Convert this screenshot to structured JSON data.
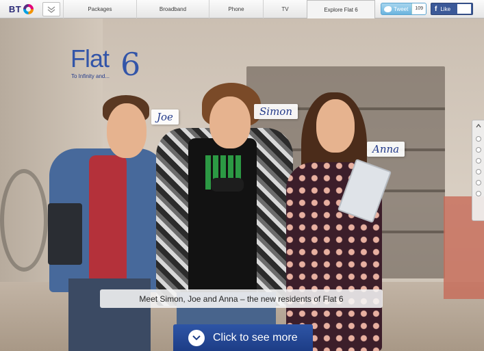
{
  "brand": {
    "logo_text": "BT"
  },
  "nav": {
    "tabs": [
      {
        "label": "Packages"
      },
      {
        "label": "Broadband"
      },
      {
        "label": "Phone"
      },
      {
        "label": "TV"
      },
      {
        "label": "Explore Flat 6"
      }
    ],
    "active_tab": "Explore Flat 6"
  },
  "social": {
    "tweet_label": "Tweet",
    "tweet_count": "109",
    "like_label": "Like"
  },
  "hero": {
    "logo_word": "Flat",
    "logo_number": "6",
    "logo_tagline": "To Infinity and...",
    "names": {
      "joe": "Joe",
      "simon": "Simon",
      "anna": "Anna"
    },
    "caption": "Meet Simon, Joe and Anna – the new residents of Flat 6",
    "cta_label": "Click to see more"
  },
  "side_nav": {
    "dot_count": 6
  },
  "colors": {
    "accent": "#1d3d86",
    "brand_blue": "#3355a8",
    "facebook": "#3b5998",
    "twitter": "#6ab4df"
  },
  "icons": [
    "chevron-down-icon",
    "twitter-bird-icon",
    "facebook-icon",
    "chevron-up-icon"
  ]
}
